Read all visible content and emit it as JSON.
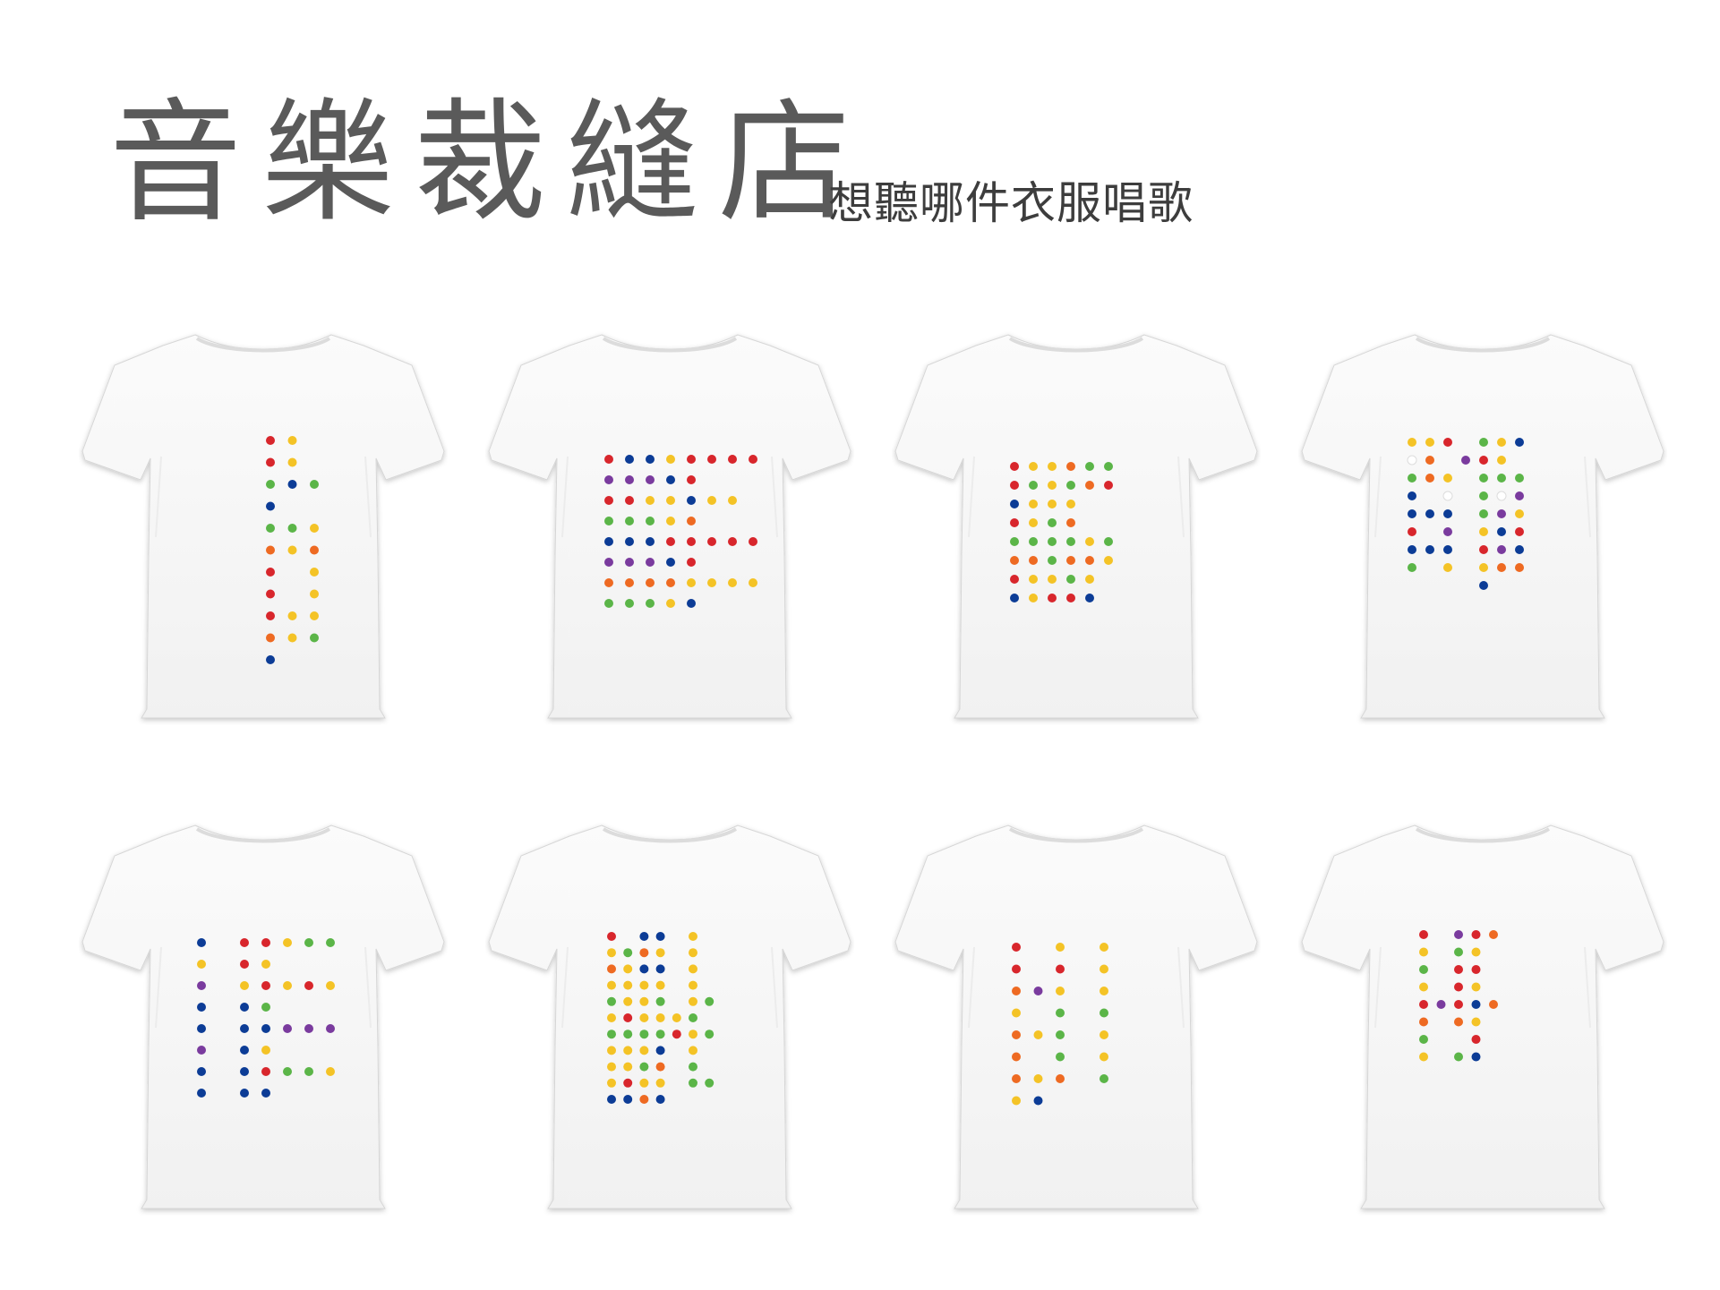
{
  "title": "音樂裁縫店",
  "subtitle": "想聽哪件衣服唱歌",
  "colors": {
    "R": "#d8262c",
    "Y": "#f4c326",
    "G": "#5bb548",
    "B": "#0c3c96",
    "O": "#ee6a22",
    "P": "#7a3b9e",
    "W": "#ffffff"
  },
  "shirts": [
    {
      "id": "shirt-1",
      "dots": [
        [
          0,
          0,
          "R"
        ],
        [
          1,
          0,
          "Y"
        ],
        [
          0,
          1,
          "R"
        ],
        [
          1,
          1,
          "Y"
        ],
        [
          0,
          2,
          "G"
        ],
        [
          1,
          2,
          "B"
        ],
        [
          2,
          2,
          "G"
        ],
        [
          0,
          3,
          "B"
        ],
        [
          0,
          4,
          "G"
        ],
        [
          1,
          4,
          "G"
        ],
        [
          2,
          4,
          "Y"
        ],
        [
          0,
          5,
          "O"
        ],
        [
          1,
          5,
          "Y"
        ],
        [
          2,
          5,
          "O"
        ],
        [
          0,
          6,
          "R"
        ],
        [
          2,
          6,
          "Y"
        ],
        [
          0,
          7,
          "R"
        ],
        [
          2,
          7,
          "Y"
        ],
        [
          0,
          8,
          "R"
        ],
        [
          1,
          8,
          "Y"
        ],
        [
          2,
          8,
          "Y"
        ],
        [
          0,
          9,
          "O"
        ],
        [
          1,
          9,
          "Y"
        ],
        [
          2,
          9,
          "G"
        ],
        [
          0,
          10,
          "B"
        ]
      ]
    },
    {
      "id": "shirt-2",
      "dots": [
        [
          0,
          0,
          "R"
        ],
        [
          1,
          0,
          "B"
        ],
        [
          2,
          0,
          "B"
        ],
        [
          3,
          0,
          "Y"
        ],
        [
          4,
          0,
          "R"
        ],
        [
          5,
          0,
          "R"
        ],
        [
          6,
          0,
          "R"
        ],
        [
          7,
          0,
          "R"
        ],
        [
          0,
          1,
          "P"
        ],
        [
          1,
          1,
          "P"
        ],
        [
          2,
          1,
          "P"
        ],
        [
          3,
          1,
          "B"
        ],
        [
          4,
          1,
          "R"
        ],
        [
          0,
          2,
          "R"
        ],
        [
          1,
          2,
          "R"
        ],
        [
          2,
          2,
          "Y"
        ],
        [
          3,
          2,
          "Y"
        ],
        [
          4,
          2,
          "B"
        ],
        [
          5,
          2,
          "Y"
        ],
        [
          6,
          2,
          "Y"
        ],
        [
          0,
          3,
          "G"
        ],
        [
          1,
          3,
          "G"
        ],
        [
          2,
          3,
          "G"
        ],
        [
          3,
          3,
          "Y"
        ],
        [
          4,
          3,
          "O"
        ],
        [
          0,
          4,
          "B"
        ],
        [
          1,
          4,
          "B"
        ],
        [
          2,
          4,
          "B"
        ],
        [
          3,
          4,
          "R"
        ],
        [
          4,
          4,
          "R"
        ],
        [
          5,
          4,
          "R"
        ],
        [
          6,
          4,
          "R"
        ],
        [
          7,
          4,
          "R"
        ],
        [
          0,
          5,
          "P"
        ],
        [
          1,
          5,
          "P"
        ],
        [
          2,
          5,
          "P"
        ],
        [
          3,
          5,
          "B"
        ],
        [
          4,
          5,
          "R"
        ],
        [
          0,
          6,
          "O"
        ],
        [
          1,
          6,
          "O"
        ],
        [
          2,
          6,
          "O"
        ],
        [
          3,
          6,
          "O"
        ],
        [
          4,
          6,
          "Y"
        ],
        [
          5,
          6,
          "Y"
        ],
        [
          6,
          6,
          "Y"
        ],
        [
          7,
          6,
          "Y"
        ],
        [
          0,
          7,
          "G"
        ],
        [
          1,
          7,
          "G"
        ],
        [
          2,
          7,
          "G"
        ],
        [
          3,
          7,
          "Y"
        ],
        [
          4,
          7,
          "B"
        ]
      ]
    },
    {
      "id": "shirt-3",
      "dots": [
        [
          0,
          0,
          "R"
        ],
        [
          1,
          0,
          "Y"
        ],
        [
          2,
          0,
          "Y"
        ],
        [
          3,
          0,
          "O"
        ],
        [
          4,
          0,
          "G"
        ],
        [
          5,
          0,
          "G"
        ],
        [
          0,
          1,
          "R"
        ],
        [
          1,
          1,
          "G"
        ],
        [
          2,
          1,
          "Y"
        ],
        [
          3,
          1,
          "G"
        ],
        [
          4,
          1,
          "O"
        ],
        [
          5,
          1,
          "R"
        ],
        [
          0,
          2,
          "B"
        ],
        [
          1,
          2,
          "Y"
        ],
        [
          2,
          2,
          "Y"
        ],
        [
          3,
          2,
          "Y"
        ],
        [
          0,
          3,
          "R"
        ],
        [
          1,
          3,
          "Y"
        ],
        [
          2,
          3,
          "G"
        ],
        [
          3,
          3,
          "O"
        ],
        [
          0,
          4,
          "G"
        ],
        [
          1,
          4,
          "G"
        ],
        [
          2,
          4,
          "G"
        ],
        [
          3,
          4,
          "G"
        ],
        [
          4,
          4,
          "Y"
        ],
        [
          5,
          4,
          "G"
        ],
        [
          0,
          5,
          "O"
        ],
        [
          1,
          5,
          "O"
        ],
        [
          2,
          5,
          "G"
        ],
        [
          3,
          5,
          "O"
        ],
        [
          4,
          5,
          "O"
        ],
        [
          5,
          5,
          "Y"
        ],
        [
          0,
          6,
          "R"
        ],
        [
          1,
          6,
          "Y"
        ],
        [
          2,
          6,
          "Y"
        ],
        [
          3,
          6,
          "G"
        ],
        [
          4,
          6,
          "Y"
        ],
        [
          0,
          7,
          "B"
        ],
        [
          1,
          7,
          "Y"
        ],
        [
          2,
          7,
          "R"
        ],
        [
          3,
          7,
          "R"
        ],
        [
          4,
          7,
          "B"
        ]
      ]
    },
    {
      "id": "shirt-4",
      "dots": [
        [
          0,
          0,
          "Y"
        ],
        [
          1,
          0,
          "Y"
        ],
        [
          2,
          0,
          "R"
        ],
        [
          4,
          0,
          "G"
        ],
        [
          5,
          0,
          "Y"
        ],
        [
          6,
          0,
          "B"
        ],
        [
          0,
          1,
          "W"
        ],
        [
          1,
          1,
          "O"
        ],
        [
          3,
          1,
          "P"
        ],
        [
          4,
          1,
          "R"
        ],
        [
          5,
          1,
          "Y"
        ],
        [
          0,
          2,
          "G"
        ],
        [
          1,
          2,
          "O"
        ],
        [
          2,
          2,
          "Y"
        ],
        [
          4,
          2,
          "G"
        ],
        [
          5,
          2,
          "G"
        ],
        [
          6,
          2,
          "G"
        ],
        [
          0,
          3,
          "B"
        ],
        [
          2,
          3,
          "W"
        ],
        [
          4,
          3,
          "G"
        ],
        [
          5,
          3,
          "W"
        ],
        [
          6,
          3,
          "P"
        ],
        [
          0,
          4,
          "B"
        ],
        [
          1,
          4,
          "B"
        ],
        [
          2,
          4,
          "B"
        ],
        [
          4,
          4,
          "G"
        ],
        [
          5,
          4,
          "P"
        ],
        [
          6,
          4,
          "Y"
        ],
        [
          0,
          5,
          "R"
        ],
        [
          2,
          5,
          "P"
        ],
        [
          4,
          5,
          "Y"
        ],
        [
          5,
          5,
          "B"
        ],
        [
          6,
          5,
          "R"
        ],
        [
          0,
          6,
          "B"
        ],
        [
          1,
          6,
          "B"
        ],
        [
          2,
          6,
          "B"
        ],
        [
          4,
          6,
          "R"
        ],
        [
          5,
          6,
          "P"
        ],
        [
          6,
          6,
          "B"
        ],
        [
          0,
          7,
          "G"
        ],
        [
          2,
          7,
          "Y"
        ],
        [
          4,
          7,
          "Y"
        ],
        [
          5,
          7,
          "O"
        ],
        [
          6,
          7,
          "O"
        ],
        [
          4,
          8,
          "B"
        ]
      ]
    },
    {
      "id": "shirt-5",
      "dots": [
        [
          0,
          0,
          "B"
        ],
        [
          2,
          0,
          "R"
        ],
        [
          3,
          0,
          "R"
        ],
        [
          4,
          0,
          "Y"
        ],
        [
          5,
          0,
          "G"
        ],
        [
          6,
          0,
          "G"
        ],
        [
          0,
          1,
          "Y"
        ],
        [
          2,
          1,
          "R"
        ],
        [
          3,
          1,
          "Y"
        ],
        [
          0,
          2,
          "P"
        ],
        [
          2,
          2,
          "Y"
        ],
        [
          3,
          2,
          "R"
        ],
        [
          4,
          2,
          "Y"
        ],
        [
          5,
          2,
          "R"
        ],
        [
          6,
          2,
          "Y"
        ],
        [
          0,
          3,
          "B"
        ],
        [
          2,
          3,
          "B"
        ],
        [
          3,
          3,
          "G"
        ],
        [
          0,
          4,
          "B"
        ],
        [
          2,
          4,
          "B"
        ],
        [
          3,
          4,
          "B"
        ],
        [
          4,
          4,
          "P"
        ],
        [
          5,
          4,
          "P"
        ],
        [
          6,
          4,
          "P"
        ],
        [
          0,
          5,
          "P"
        ],
        [
          2,
          5,
          "B"
        ],
        [
          3,
          5,
          "Y"
        ],
        [
          0,
          6,
          "B"
        ],
        [
          2,
          6,
          "B"
        ],
        [
          3,
          6,
          "R"
        ],
        [
          4,
          6,
          "G"
        ],
        [
          5,
          6,
          "G"
        ],
        [
          6,
          6,
          "Y"
        ],
        [
          0,
          7,
          "B"
        ],
        [
          2,
          7,
          "B"
        ],
        [
          3,
          7,
          "B"
        ]
      ]
    },
    {
      "id": "shirt-6",
      "dots": [
        [
          0,
          0,
          "R"
        ],
        [
          2,
          0,
          "B"
        ],
        [
          3,
          0,
          "B"
        ],
        [
          5,
          0,
          "Y"
        ],
        [
          0,
          1,
          "Y"
        ],
        [
          1,
          1,
          "G"
        ],
        [
          2,
          1,
          "O"
        ],
        [
          3,
          1,
          "Y"
        ],
        [
          5,
          1,
          "Y"
        ],
        [
          0,
          2,
          "O"
        ],
        [
          1,
          2,
          "Y"
        ],
        [
          2,
          2,
          "B"
        ],
        [
          3,
          2,
          "B"
        ],
        [
          5,
          2,
          "Y"
        ],
        [
          0,
          3,
          "Y"
        ],
        [
          1,
          3,
          "Y"
        ],
        [
          2,
          3,
          "Y"
        ],
        [
          3,
          3,
          "Y"
        ],
        [
          5,
          3,
          "Y"
        ],
        [
          0,
          4,
          "G"
        ],
        [
          1,
          4,
          "Y"
        ],
        [
          2,
          4,
          "Y"
        ],
        [
          3,
          4,
          "G"
        ],
        [
          5,
          4,
          "Y"
        ],
        [
          6,
          4,
          "G"
        ],
        [
          0,
          5,
          "Y"
        ],
        [
          1,
          5,
          "R"
        ],
        [
          2,
          5,
          "Y"
        ],
        [
          3,
          5,
          "Y"
        ],
        [
          4,
          5,
          "Y"
        ],
        [
          5,
          5,
          "G"
        ],
        [
          0,
          6,
          "G"
        ],
        [
          1,
          6,
          "G"
        ],
        [
          2,
          6,
          "G"
        ],
        [
          3,
          6,
          "G"
        ],
        [
          4,
          6,
          "R"
        ],
        [
          5,
          6,
          "Y"
        ],
        [
          6,
          6,
          "G"
        ],
        [
          0,
          7,
          "Y"
        ],
        [
          1,
          7,
          "Y"
        ],
        [
          2,
          7,
          "Y"
        ],
        [
          3,
          7,
          "B"
        ],
        [
          5,
          7,
          "Y"
        ],
        [
          0,
          8,
          "Y"
        ],
        [
          1,
          8,
          "Y"
        ],
        [
          2,
          8,
          "G"
        ],
        [
          3,
          8,
          "O"
        ],
        [
          5,
          8,
          "G"
        ],
        [
          0,
          9,
          "Y"
        ],
        [
          1,
          9,
          "R"
        ],
        [
          2,
          9,
          "Y"
        ],
        [
          3,
          9,
          "Y"
        ],
        [
          5,
          9,
          "G"
        ],
        [
          6,
          9,
          "G"
        ],
        [
          0,
          10,
          "B"
        ],
        [
          1,
          10,
          "B"
        ],
        [
          2,
          10,
          "O"
        ],
        [
          3,
          10,
          "B"
        ]
      ]
    },
    {
      "id": "shirt-7",
      "dots": [
        [
          0,
          0,
          "R"
        ],
        [
          2,
          0,
          "Y"
        ],
        [
          4,
          0,
          "Y"
        ],
        [
          0,
          1,
          "R"
        ],
        [
          2,
          1,
          "R"
        ],
        [
          4,
          1,
          "Y"
        ],
        [
          0,
          2,
          "O"
        ],
        [
          1,
          2,
          "P"
        ],
        [
          2,
          2,
          "Y"
        ],
        [
          4,
          2,
          "Y"
        ],
        [
          0,
          3,
          "Y"
        ],
        [
          2,
          3,
          "G"
        ],
        [
          4,
          3,
          "G"
        ],
        [
          0,
          4,
          "O"
        ],
        [
          1,
          4,
          "Y"
        ],
        [
          2,
          4,
          "G"
        ],
        [
          4,
          4,
          "Y"
        ],
        [
          0,
          5,
          "O"
        ],
        [
          2,
          5,
          "G"
        ],
        [
          4,
          5,
          "Y"
        ],
        [
          0,
          6,
          "O"
        ],
        [
          1,
          6,
          "Y"
        ],
        [
          2,
          6,
          "O"
        ],
        [
          4,
          6,
          "G"
        ],
        [
          0,
          7,
          "Y"
        ],
        [
          1,
          7,
          "B"
        ]
      ]
    },
    {
      "id": "shirt-8",
      "dots": [
        [
          0,
          0,
          "R"
        ],
        [
          2,
          0,
          "P"
        ],
        [
          3,
          0,
          "R"
        ],
        [
          4,
          0,
          "O"
        ],
        [
          0,
          1,
          "Y"
        ],
        [
          2,
          1,
          "G"
        ],
        [
          3,
          1,
          "Y"
        ],
        [
          0,
          2,
          "G"
        ],
        [
          2,
          2,
          "R"
        ],
        [
          3,
          2,
          "R"
        ],
        [
          0,
          3,
          "Y"
        ],
        [
          2,
          3,
          "R"
        ],
        [
          3,
          3,
          "Y"
        ],
        [
          0,
          4,
          "R"
        ],
        [
          1,
          4,
          "P"
        ],
        [
          2,
          4,
          "R"
        ],
        [
          3,
          4,
          "B"
        ],
        [
          4,
          4,
          "O"
        ],
        [
          0,
          5,
          "O"
        ],
        [
          2,
          5,
          "O"
        ],
        [
          3,
          5,
          "Y"
        ],
        [
          0,
          6,
          "G"
        ],
        [
          3,
          6,
          "R"
        ],
        [
          0,
          7,
          "Y"
        ],
        [
          2,
          7,
          "G"
        ],
        [
          3,
          7,
          "B"
        ]
      ]
    }
  ]
}
